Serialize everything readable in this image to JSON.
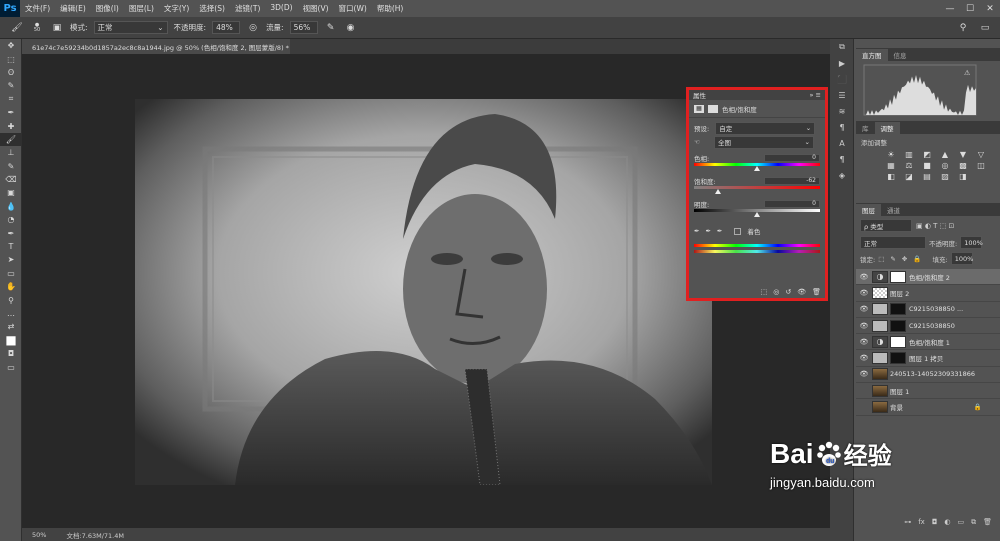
{
  "app_logo": "Ps",
  "menu": [
    "文件(F)",
    "编辑(E)",
    "图像(I)",
    "图层(L)",
    "文字(Y)",
    "选择(S)",
    "滤镜(T)",
    "3D(D)",
    "视图(V)",
    "窗口(W)",
    "帮助(H)"
  ],
  "window_controls": [
    "—",
    "☐",
    "✕"
  ],
  "options": {
    "brush_size": "50",
    "mode_label": "模式:",
    "mode_value": "正常",
    "opacity_label": "不透明度:",
    "opacity_value": "48%",
    "flow_label": "流量:",
    "flow_value": "56%"
  },
  "document": {
    "tab_title": "61e74c7e59234b0d1857a2ec8c8a1944.jpg @ 50% (色相/饱和度 2, 图层蒙版/8) *",
    "tab_close": "×"
  },
  "status": {
    "zoom": "50%",
    "doc_info": "文档:7.63M/71.4M"
  },
  "properties": {
    "title": "属性",
    "adjust_name": "色相/饱和度",
    "preset_label": "预设:",
    "preset_value": "自定",
    "channel_value": "全图",
    "hue_label": "色相:",
    "hue_value": "0",
    "saturation_label": "饱和度:",
    "saturation_value": "-62",
    "lightness_label": "明度:",
    "lightness_value": "0",
    "colorize_label": "着色",
    "hue_fraction": 0.5,
    "saturation_fraction": 0.19,
    "lightness_fraction": 0.5
  },
  "histogram_tabs": [
    "直方图",
    "信息"
  ],
  "adjust_tabs": [
    "库",
    "调整"
  ],
  "adjust_add_label": "添加调整",
  "layers_tabs": [
    "图层",
    "通道"
  ],
  "layers_kind": "ρ 类型",
  "blend_mode": "正常",
  "opacity_label": "不透明度:",
  "opacity_value": "100%",
  "lock_label": "锁定:",
  "fill_label": "填充:",
  "fill_value": "100%",
  "layers": [
    {
      "name": "色相/饱和度 2",
      "type": "adjust",
      "selected": true
    },
    {
      "name": "图层 2",
      "type": "pixel"
    },
    {
      "name": "C9215038850 ...",
      "type": "masked"
    },
    {
      "name": "C9215038850",
      "type": "masked"
    },
    {
      "name": "色相/饱和度 1",
      "type": "adjust"
    },
    {
      "name": "图层 1 拷贝",
      "type": "masked"
    },
    {
      "name": "240513-14052309331866",
      "type": "photo"
    },
    {
      "name": "图层 1",
      "type": "photo",
      "hidden": true
    },
    {
      "name": "背景",
      "type": "photo",
      "hidden": true,
      "locked": true
    }
  ],
  "watermark": {
    "brand": "Bai",
    "brand2": "经验",
    "url": "jingyan.baidu.com"
  }
}
